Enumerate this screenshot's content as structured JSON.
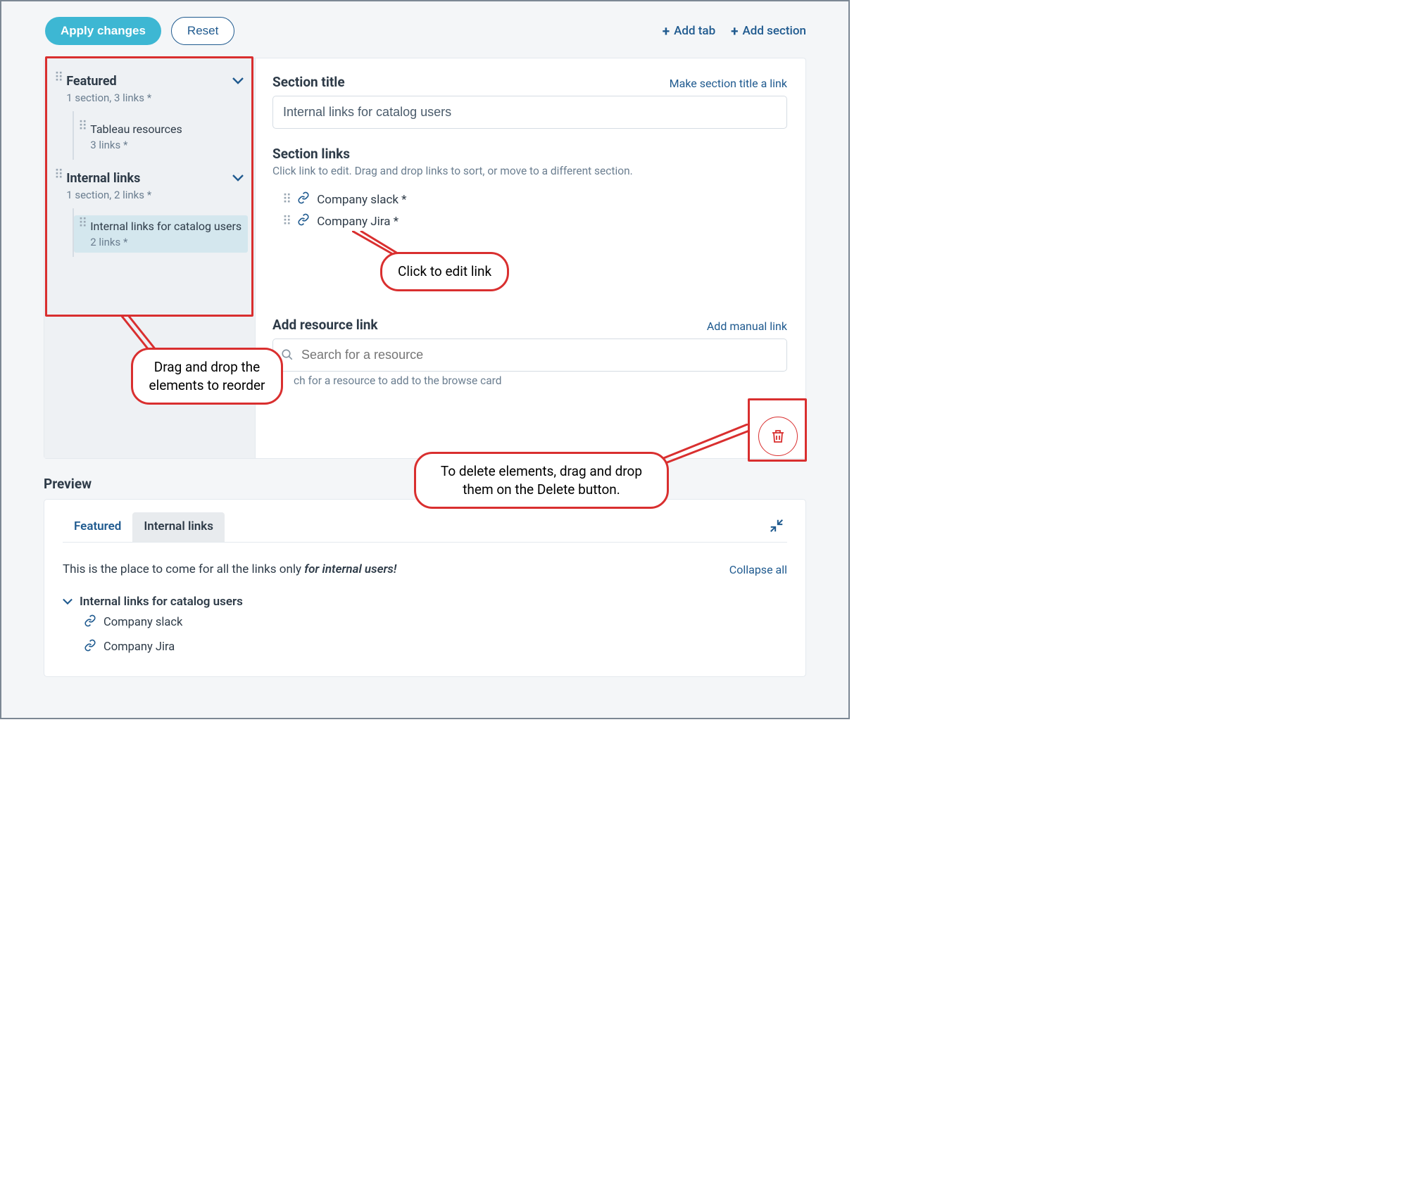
{
  "toolbar": {
    "apply_label": "Apply changes",
    "reset_label": "Reset",
    "add_tab_label": "Add tab",
    "add_section_label": "Add section"
  },
  "sidebar": {
    "groups": [
      {
        "title": "Featured",
        "meta": "1 section, 3 links *",
        "children": [
          {
            "title": "Tableau resources",
            "meta": "3 links *"
          }
        ]
      },
      {
        "title": "Internal links",
        "meta": "1 section, 2 links *",
        "children": [
          {
            "title": "Internal links for catalog users",
            "meta": "2 links *",
            "active": true
          }
        ]
      }
    ]
  },
  "editor": {
    "section_title_label": "Section title",
    "make_title_link": "Make section title a link",
    "section_title_value": "Internal links for catalog users",
    "section_links_label": "Section links",
    "section_links_help": "Click link to edit. Drag and drop links to sort, or move to a different section.",
    "links": [
      {
        "label": "Company slack *"
      },
      {
        "label": "Company Jira *"
      }
    ],
    "add_resource_label": "Add resource link",
    "add_manual_link": "Add manual link",
    "search_placeholder": "Search for a resource",
    "search_help": "ch for a resource to add to the browse card"
  },
  "preview": {
    "heading": "Preview",
    "tabs": [
      {
        "label": "Featured",
        "active": false
      },
      {
        "label": "Internal links",
        "active": true
      }
    ],
    "description_plain": "This is the place to come for all the links only ",
    "description_em": "for internal users!",
    "collapse_all": "Collapse all",
    "section": {
      "title": "Internal links for catalog users",
      "links": [
        {
          "label": "Company slack"
        },
        {
          "label": "Company Jira"
        }
      ]
    }
  },
  "annotations": {
    "reorder": "Drag and drop the elements to reorder",
    "edit_link": "Click to edit link",
    "delete": "To delete elements, drag and drop them on the Delete button."
  }
}
